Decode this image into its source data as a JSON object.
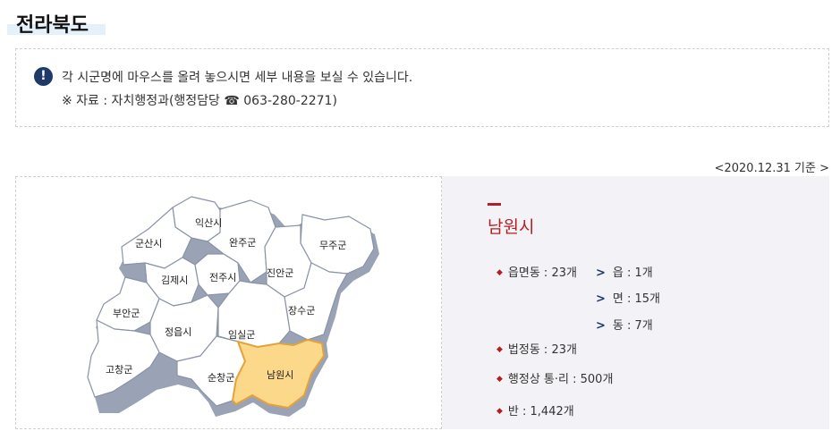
{
  "header": {
    "title": "전라북도"
  },
  "notice": {
    "icon": "exclamation-circle-icon",
    "line1": "각 시군명에 마우스를 올려 놓으시면 세부 내용을 보실 수 있습니다.",
    "line2": "※ 자료 : 자치행정과(행정담당 ☎ 063-280-2271)"
  },
  "date_basis": "<2020.12.31 기준 >",
  "map": {
    "selected": "남원시",
    "regions": [
      "익산시",
      "군산시",
      "완주군",
      "무주군",
      "김제시",
      "전주시",
      "진안군",
      "부안군",
      "정읍시",
      "장수군",
      "임실군",
      "고창군",
      "순창군",
      "남원시"
    ],
    "colors": {
      "fill": "#ffffff",
      "stroke": "#8a93a6",
      "shadow": "#9aa3b5",
      "selected_fill": "#fbd88a",
      "selected_stroke": "#e3a23a"
    }
  },
  "info": {
    "city": "남원시",
    "stats": [
      {
        "label": "읍면동 : 23개"
      },
      {
        "label": "법정동 : 23개"
      },
      {
        "label": "행정상 통·리 : 500개"
      },
      {
        "label": "반 : 1,442개"
      }
    ],
    "sub": [
      "읍 : 1개",
      "면 : 15개",
      "동 : 7개"
    ],
    "accent": "#b51f24"
  }
}
